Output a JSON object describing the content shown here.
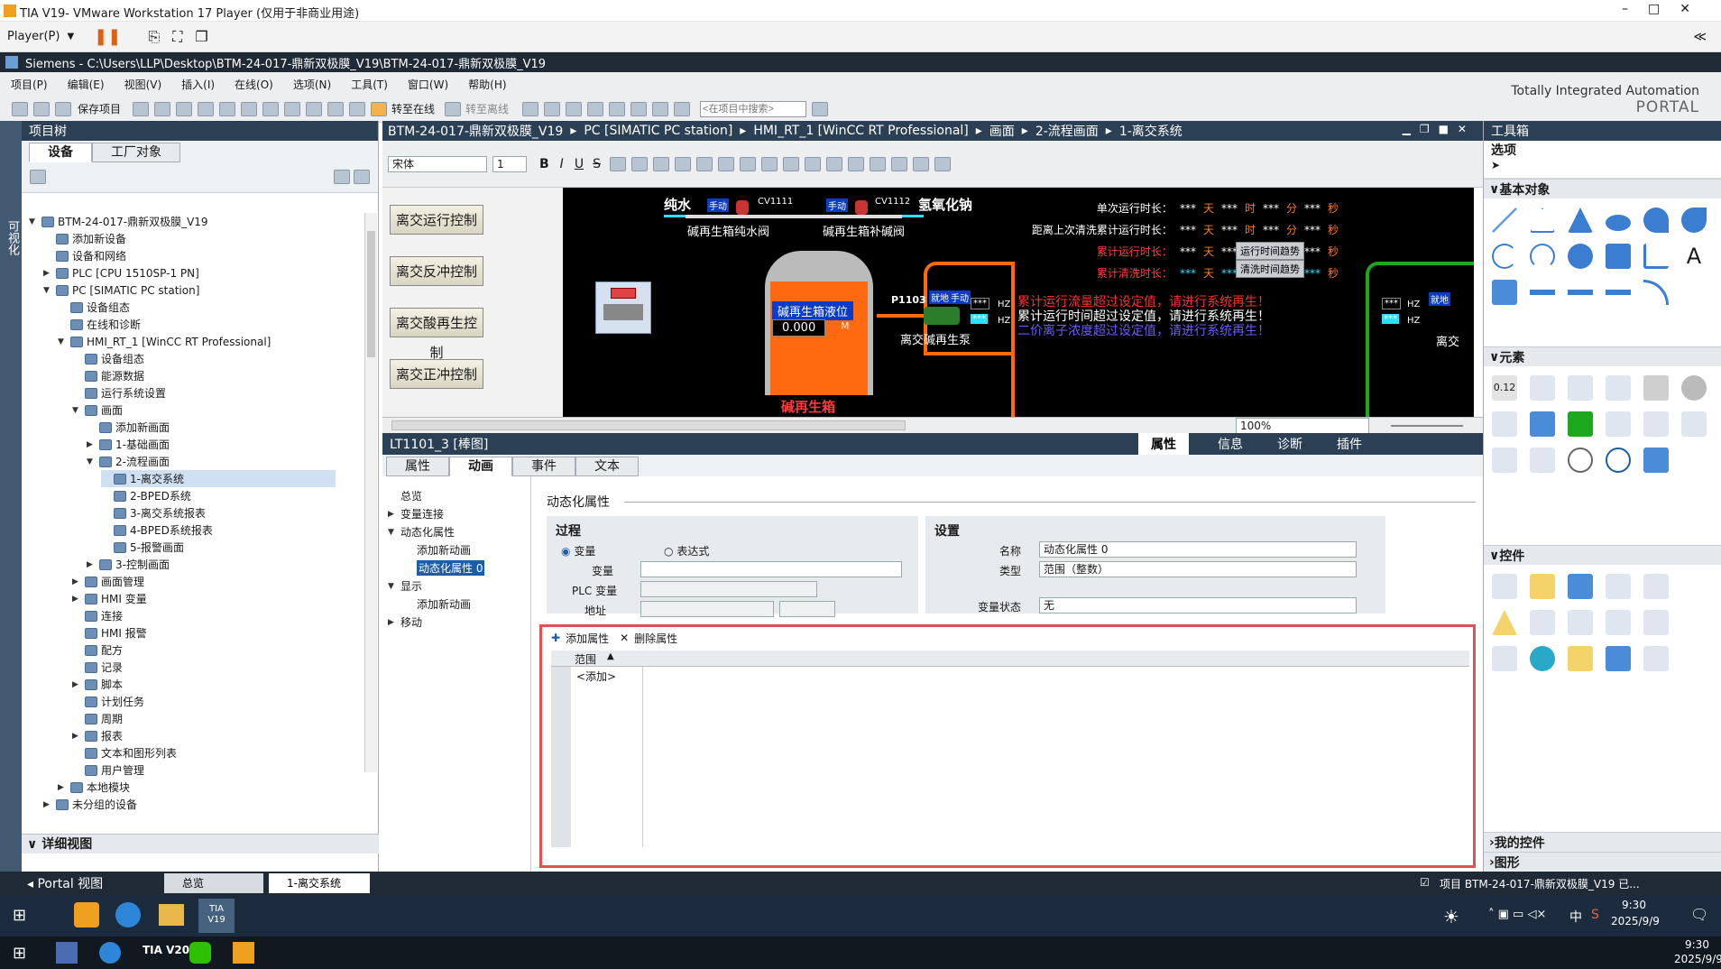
{
  "vmware": {
    "title": "TIA V19- VMware Workstation 17 Player (仅用于非商业用途)",
    "player_menu": "Player(P)"
  },
  "tia": {
    "title": "Siemens  -  C:\\Users\\LLP\\Desktop\\BTM-24-017-鼎新双极膜_V19\\BTM-24-017-鼎新双极膜_V19",
    "menu": [
      "项目(P)",
      "编辑(E)",
      "视图(V)",
      "插入(I)",
      "在线(O)",
      "选项(N)",
      "工具(T)",
      "窗口(W)",
      "帮助(H)"
    ],
    "toolbar": {
      "save_project": "保存项目",
      "go_online": "转至在线",
      "go_offline": "转至离线",
      "search_placeholder": "<在项目中搜索>"
    },
    "brand_line1": "Totally Integrated Automation",
    "brand_line2": "PORTAL",
    "left_strip": "可视化"
  },
  "project_tree": {
    "title": "项目树",
    "tabs": [
      "设备",
      "工厂对象"
    ],
    "items": [
      {
        "label": "BTM-24-017-鼎新双极膜_V19",
        "level": 0,
        "toggle": "▼"
      },
      {
        "label": "添加新设备",
        "level": 1,
        "toggle": ""
      },
      {
        "label": "设备和网络",
        "level": 1,
        "toggle": ""
      },
      {
        "label": "PLC [CPU 1510SP-1 PN]",
        "level": 1,
        "toggle": "▶"
      },
      {
        "label": "PC [SIMATIC PC station]",
        "level": 1,
        "toggle": "▼"
      },
      {
        "label": "设备组态",
        "level": 2,
        "toggle": ""
      },
      {
        "label": "在线和诊断",
        "level": 2,
        "toggle": ""
      },
      {
        "label": "HMI_RT_1 [WinCC RT Professional]",
        "level": 2,
        "toggle": "▼"
      },
      {
        "label": "设备组态",
        "level": 3,
        "toggle": ""
      },
      {
        "label": "能源数据",
        "level": 3,
        "toggle": ""
      },
      {
        "label": "运行系统设置",
        "level": 3,
        "toggle": ""
      },
      {
        "label": "画面",
        "level": 3,
        "toggle": "▼"
      },
      {
        "label": "添加新画面",
        "level": 4,
        "toggle": ""
      },
      {
        "label": "1-基础画面",
        "level": 4,
        "toggle": "▶"
      },
      {
        "label": "2-流程画面",
        "level": 4,
        "toggle": "▼"
      },
      {
        "label": "1-离交系统",
        "level": 5,
        "toggle": ""
      },
      {
        "label": "2-BPED系统",
        "level": 5,
        "toggle": ""
      },
      {
        "label": "3-离交系统报表",
        "level": 5,
        "toggle": ""
      },
      {
        "label": "4-BPED系统报表",
        "level": 5,
        "toggle": ""
      },
      {
        "label": "5-报警画面",
        "level": 5,
        "toggle": ""
      },
      {
        "label": "3-控制画面",
        "level": 4,
        "toggle": "▶"
      },
      {
        "label": "画面管理",
        "level": 3,
        "toggle": "▶"
      },
      {
        "label": "HMI 变量",
        "level": 3,
        "toggle": "▶"
      },
      {
        "label": "连接",
        "level": 3,
        "toggle": ""
      },
      {
        "label": "HMI 报警",
        "level": 3,
        "toggle": ""
      },
      {
        "label": "配方",
        "level": 3,
        "toggle": ""
      },
      {
        "label": "记录",
        "level": 3,
        "toggle": ""
      },
      {
        "label": "脚本",
        "level": 3,
        "toggle": "▶"
      },
      {
        "label": "计划任务",
        "level": 3,
        "toggle": ""
      },
      {
        "label": "周期",
        "level": 3,
        "toggle": ""
      },
      {
        "label": "报表",
        "level": 3,
        "toggle": "▶"
      },
      {
        "label": "文本和图形列表",
        "level": 3,
        "toggle": ""
      },
      {
        "label": "用户管理",
        "level": 3,
        "toggle": ""
      },
      {
        "label": "本地模块",
        "level": 2,
        "toggle": "▶"
      },
      {
        "label": "未分组的设备",
        "level": 1,
        "toggle": "▶"
      }
    ],
    "detail_view": "详细视图"
  },
  "editor": {
    "breadcrumb": [
      "BTM-24-017-鼎新双极膜_V19",
      "PC [SIMATIC PC station]",
      "HMI_RT_1 [WinCC RT Professional]",
      "画面",
      "2-流程画面",
      "1-离交系统"
    ],
    "font_name": "宋体",
    "font_size": "1",
    "zoom": "100%"
  },
  "hmi": {
    "nav_buttons": [
      "离交运行控制",
      "离交反冲控制",
      "离交酸再生控制",
      "离交正冲控制"
    ],
    "pure_water": "纯水",
    "naoh": "氢氧化钠",
    "manual": "手动",
    "valve1_tag": "CV1111",
    "valve2_tag": "CV1112",
    "valve1_label": "碱再生箱纯水阀",
    "valve2_label": "碱再生箱补碱阀",
    "tank_level_label": "碱再生箱液位",
    "tank_level_value": "0.000",
    "tank_level_unit": "M",
    "tank_name": "碱再生箱",
    "pump_tag": "P1103",
    "pump_label": "离交碱再生泵",
    "pump_buttons": [
      "就地",
      "手动"
    ],
    "hz": "HZ",
    "stars": "***",
    "runtime_rows": [
      {
        "label": "单次运行时长：",
        "c1": "***",
        "u1": "天",
        "c2": "***",
        "u2": "时",
        "c3": "***",
        "u3": "分",
        "c4": "***",
        "u4": "秒"
      },
      {
        "label": "距离上次清洗累计运行时长：",
        "c1": "***",
        "u1": "天",
        "c2": "***",
        "u2": "时",
        "c3": "***",
        "u3": "分",
        "c4": "***",
        "u4": "秒"
      },
      {
        "label": "累计运行时长：",
        "c1": "***",
        "u1": "天",
        "c2": "***",
        "u2": "时",
        "c3": "***",
        "u3": "分",
        "c4": "***",
        "u4": "秒"
      },
      {
        "label": "累计清洗时长：",
        "c1": "***",
        "u1": "天",
        "c2": "***",
        "u2": "时",
        "c3": "***",
        "u3": "分",
        "c4": "***",
        "u4": "秒"
      }
    ],
    "trend_buttons": [
      "运行时间趋势",
      "清洗时间趋势"
    ],
    "alarms": [
      "累计运行流量超过设定值，请进行系统再生！",
      "累计运行时间超过设定值，请进行系统再生！",
      "二价离子浓度超过设定值，请进行系统再生！"
    ],
    "pump_label_right": "离交"
  },
  "inspector": {
    "title": "LT1101_3 [棒图]",
    "right_tabs": [
      "属性",
      "信息",
      "诊断",
      "插件"
    ],
    "tabs": [
      "属性",
      "动画",
      "事件",
      "文本"
    ],
    "nav": [
      {
        "label": "总览",
        "level": 0,
        "toggle": ""
      },
      {
        "label": "变量连接",
        "level": 0,
        "toggle": "▶"
      },
      {
        "label": "动态化属性",
        "level": 0,
        "toggle": "▼"
      },
      {
        "label": "添加新动画",
        "level": 1,
        "toggle": ""
      },
      {
        "label": "动态化属性 0",
        "level": 1,
        "toggle": ""
      },
      {
        "label": "显示",
        "level": 0,
        "toggle": "▼"
      },
      {
        "label": "添加新动画",
        "level": 1,
        "toggle": ""
      },
      {
        "label": "移动",
        "level": 0,
        "toggle": "▶"
      }
    ],
    "section_title": "动态化属性",
    "process": {
      "title": "过程",
      "radio_variable": "变量",
      "radio_expression": "表达式",
      "variable_label": "变量",
      "plc_var_label": "PLC 变量",
      "address_label": "地址"
    },
    "settings": {
      "title": "设置",
      "name_label": "名称",
      "name_value": "动态化属性 0",
      "type_label": "类型",
      "type_value": "范围（整数）",
      "var_state_label": "变量状态",
      "var_state_value": "无"
    },
    "table": {
      "add_prop": "添加属性",
      "delete_prop": "删除属性",
      "col_range": "范围",
      "add_row": "<添加>"
    }
  },
  "toolbox": {
    "title": "工具箱",
    "options": "选项",
    "basic_objects": "基本对象",
    "elements": "元素",
    "controls": "控件",
    "my_controls": "我的控件",
    "graphics": "图形"
  },
  "statusbar": {
    "portal_view": "Portal 视图",
    "overview": "总览",
    "current_screen": "1-离交系统",
    "message": "项目 BTM-24-017-鼎新双极膜_V19 已..."
  },
  "taskbar": {
    "time1": "9:30",
    "date1": "2025/9/9",
    "time2": "9:30",
    "date2": "2025/9/9",
    "ime": "中",
    "tia_label": "TIA\nV19",
    "tia20": "TIA V20"
  },
  "colors": {
    "accent": "#2b3f55",
    "highlight_box": "#e05252",
    "hmi_bg": "#000000"
  }
}
